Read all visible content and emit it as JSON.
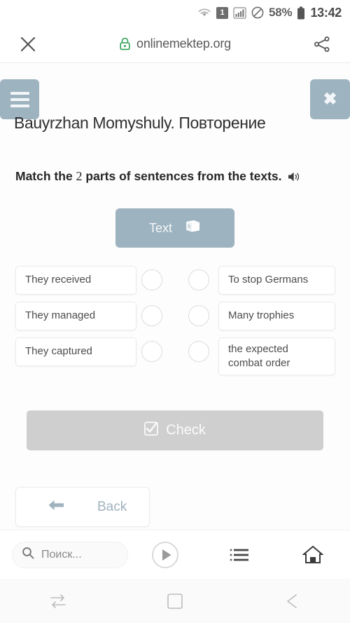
{
  "status_bar": {
    "wifi_icon": "wifi-icon",
    "sim_label": "1",
    "signal_icon": "signal-bars-icon",
    "dnd_icon": "do-not-disturb-icon",
    "battery_percent": "58%",
    "battery_icon": "battery-icon",
    "time": "13:42"
  },
  "browser_bar": {
    "close_icon": "close-icon",
    "lock_icon": "lock-icon",
    "url": "onlinemektep.org",
    "share_icon": "share-icon",
    "lock_color": "#2e9e52"
  },
  "page": {
    "menu_icon": "hamburger-menu-icon",
    "close_icon": "close-x-icon",
    "title": "Bauyrzhan Momyshuly. Повторение",
    "instruction_before": "Match the ",
    "instruction_number": "2",
    "instruction_after": " parts of sentences from the texts.",
    "speaker_icon": "speaker-icon",
    "text_button": {
      "label": "Text",
      "icon": "book-icon"
    },
    "accent_color": "#9db3bf",
    "match": {
      "left_items": [
        {
          "label": "They received"
        },
        {
          "label": "They managed"
        },
        {
          "label": "They captured"
        }
      ],
      "right_items": [
        {
          "label": "To stop Germans",
          "two_line": false
        },
        {
          "label": "Many trophies",
          "two_line": false
        },
        {
          "label": "the expected combat order",
          "two_line": true
        }
      ]
    },
    "check_button": {
      "label": "Check",
      "icon": "checkbox-checked-icon",
      "disabled_color": "#cfcfcf"
    },
    "back_button": {
      "label": "Back",
      "icon": "arrow-left-icon"
    }
  },
  "bottom_bar": {
    "search_icon": "search-icon",
    "search_placeholder": "Поиск...",
    "play_icon": "play-circle-icon",
    "list_icon": "list-icon",
    "home_icon": "home-icon"
  },
  "nav_bar": {
    "recents_icon": "recents-icon",
    "home_icon": "home-square-icon",
    "back_icon": "back-arrow-icon"
  }
}
